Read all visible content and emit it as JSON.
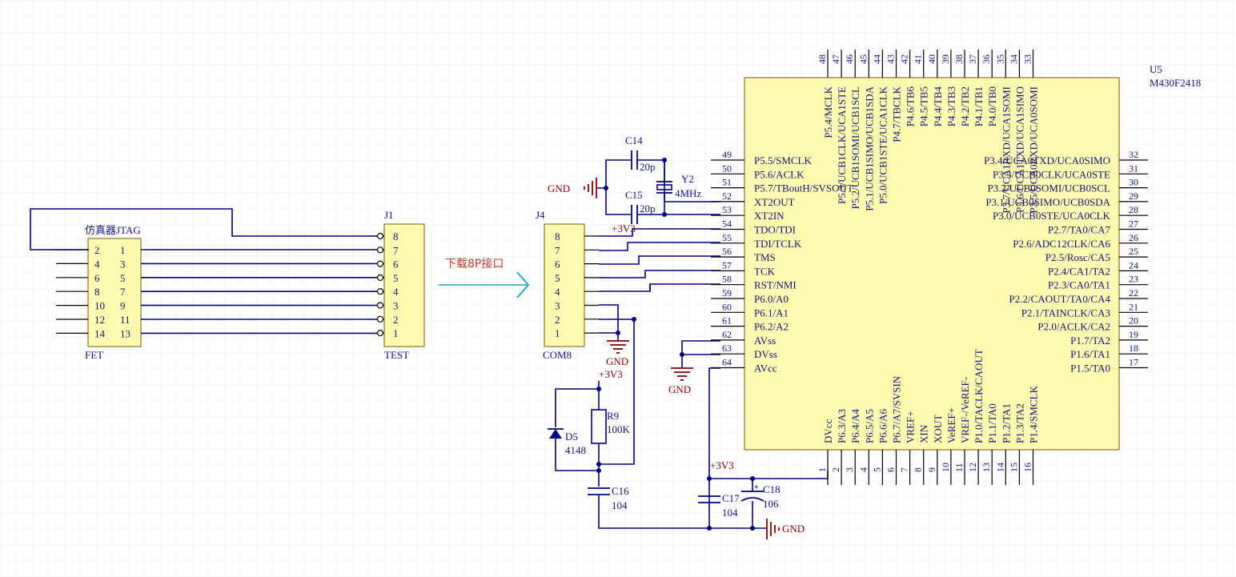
{
  "colors": {
    "wire": "#00008b",
    "text": "#13137a",
    "power_text": "#8b0000",
    "component_fill": "#fffbb0",
    "pin": "#000000",
    "grid": "#f0f0f0",
    "arrow": "#1aa3c8",
    "download_label": "#c0392b"
  },
  "fet": {
    "title": "仿真器JTAG",
    "designator": "FET",
    "rows": [
      {
        "left": "2",
        "right": "1"
      },
      {
        "left": "4",
        "right": "3"
      },
      {
        "left": "6",
        "right": "5"
      },
      {
        "left": "8",
        "right": "7"
      },
      {
        "left": "10",
        "right": "9"
      },
      {
        "left": "12",
        "right": "11"
      },
      {
        "left": "14",
        "right": "13"
      }
    ]
  },
  "j1": {
    "designator": "J1",
    "name": "TEST",
    "pins": [
      "8",
      "7",
      "6",
      "5",
      "4",
      "3",
      "2",
      "1"
    ]
  },
  "download_label": "下载8P接口",
  "j4": {
    "designator": "J4",
    "name": "COM8",
    "pins": [
      "8",
      "7",
      "6",
      "5",
      "4",
      "3",
      "2",
      "1"
    ]
  },
  "u5": {
    "designator": "U5",
    "part": "M430F2418",
    "top_pins": [
      {
        "num": "48",
        "name": "P5.4/MCLK"
      },
      {
        "num": "47",
        "name": "P5.3/UCB1CLK/UCA1STE"
      },
      {
        "num": "46",
        "name": "P5.2/UCB1SOMI/UCB1SCL"
      },
      {
        "num": "45",
        "name": "P5.1/UCB1SIMO/UCB1SDA"
      },
      {
        "num": "44",
        "name": "P5.0/UCB1STE/UCA1CLK"
      },
      {
        "num": "43",
        "name": "P4.7/TBCLK"
      },
      {
        "num": "42",
        "name": "P4.6/TB6"
      },
      {
        "num": "41",
        "name": "P4.5/TB5"
      },
      {
        "num": "40",
        "name": "P4.4/TB4"
      },
      {
        "num": "39",
        "name": "P4.3/TB3"
      },
      {
        "num": "38",
        "name": "P4.2/TB2"
      },
      {
        "num": "37",
        "name": "P4.1/TB1"
      },
      {
        "num": "36",
        "name": "P4.0/TB0"
      },
      {
        "num": "35",
        "name": "P3.7/UCA1RXD/UCA1SOMI"
      },
      {
        "num": "34",
        "name": "P3.6/UCA1TXD/UCA1SIMO"
      },
      {
        "num": "33",
        "name": "P3.5/UCA0RXD/UCA0SOMI"
      }
    ],
    "left_pins": [
      {
        "num": "49",
        "name": "P5.5/SMCLK"
      },
      {
        "num": "50",
        "name": "P5.6/ACLK"
      },
      {
        "num": "51",
        "name": "P5.7/TBoutH/SVSOUT"
      },
      {
        "num": "52",
        "name": "XT2OUT"
      },
      {
        "num": "53",
        "name": "XT2IN"
      },
      {
        "num": "54",
        "name": "TDO/TDI"
      },
      {
        "num": "55",
        "name": "TDI/TCLK"
      },
      {
        "num": "56",
        "name": "TMS"
      },
      {
        "num": "57",
        "name": "TCK"
      },
      {
        "num": "58",
        "name": "RST/NMI"
      },
      {
        "num": "59",
        "name": "P6.0/A0"
      },
      {
        "num": "60",
        "name": "P6.1/A1"
      },
      {
        "num": "61",
        "name": "P6.2/A2"
      },
      {
        "num": "62",
        "name": "AVss"
      },
      {
        "num": "63",
        "name": "DVss"
      },
      {
        "num": "64",
        "name": "AVcc"
      }
    ],
    "right_pins": [
      {
        "num": "32",
        "name": "P3.4/UCA0TXD/UCA0SIMO"
      },
      {
        "num": "31",
        "name": "P3.3/UCB0CLK/UCA0STE"
      },
      {
        "num": "30",
        "name": "P3.2/UCB0SOMI/UCB0SCL"
      },
      {
        "num": "29",
        "name": "P3.1/UCB0SIMO/UCB0SDA"
      },
      {
        "num": "28",
        "name": "P3.0/UCB0STE/UCA0CLK"
      },
      {
        "num": "27",
        "name": "P2.7/TA0/CA7"
      },
      {
        "num": "26",
        "name": "P2.6/ADC12CLK/CA6"
      },
      {
        "num": "25",
        "name": "P2.5/Rosc/CA5"
      },
      {
        "num": "24",
        "name": "P2.4/CA1/TA2"
      },
      {
        "num": "23",
        "name": "P2.3/CA0/TA1"
      },
      {
        "num": "22",
        "name": "P2.2/CAOUT/TA0/CA4"
      },
      {
        "num": "21",
        "name": "P2.1/TAINCLK/CA3"
      },
      {
        "num": "20",
        "name": "P2.0/ACLK/CA2"
      },
      {
        "num": "19",
        "name": "P1.7/TA2"
      },
      {
        "num": "18",
        "name": "P1.6/TA1"
      },
      {
        "num": "17",
        "name": "P1.5/TA0"
      }
    ],
    "bottom_pins": [
      {
        "num": "1",
        "name": "DVcc"
      },
      {
        "num": "2",
        "name": "P6.3/A3"
      },
      {
        "num": "3",
        "name": "P6.4/A4"
      },
      {
        "num": "4",
        "name": "P6.5/A5"
      },
      {
        "num": "5",
        "name": "P6.6/A6"
      },
      {
        "num": "6",
        "name": "P6.7/A7/SVSIN"
      },
      {
        "num": "7",
        "name": "VREF+"
      },
      {
        "num": "8",
        "name": "XIN"
      },
      {
        "num": "9",
        "name": "XOUT"
      },
      {
        "num": "10",
        "name": "VeREF+"
      },
      {
        "num": "11",
        "name": "VREF-/VeREF-"
      },
      {
        "num": "12",
        "name": "P1.0/TACLK/CAOUT"
      },
      {
        "num": "13",
        "name": "P1.1/TA0"
      },
      {
        "num": "14",
        "name": "P1.2/TA1"
      },
      {
        "num": "15",
        "name": "P1.3/TA2"
      },
      {
        "num": "16",
        "name": "P1.4/SMCLK"
      }
    ]
  },
  "c14": {
    "designator": "C14",
    "value": "20p"
  },
  "c15": {
    "designator": "C15",
    "value": "20p"
  },
  "y2": {
    "designator": "Y2",
    "value": "4MHz"
  },
  "c16": {
    "designator": "C16",
    "value": "104"
  },
  "c17": {
    "designator": "C17",
    "value": "104"
  },
  "c18": {
    "designator": "C18",
    "value": "106"
  },
  "r9": {
    "designator": "R9",
    "value": "100K"
  },
  "d5": {
    "designator": "D5",
    "value": "4148"
  },
  "power": {
    "gnd": "GND",
    "vcc": "+3V3"
  }
}
